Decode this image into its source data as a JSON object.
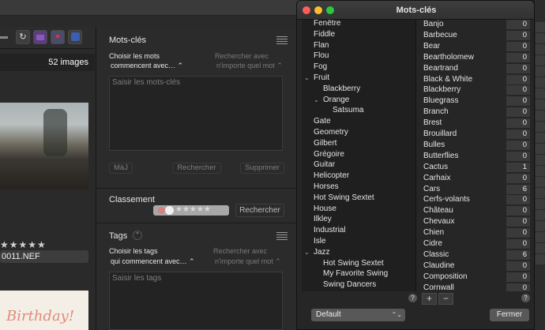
{
  "left_app": {
    "image_count": "52 images",
    "filename": "0011.NEF",
    "stars": "★★★★★",
    "card_text": "Birthday!",
    "toolbar_icons": [
      "refresh-icon",
      "folder-icon",
      "pin-icon",
      "app-icon"
    ]
  },
  "keywords_panel": {
    "title": "Mots-clés",
    "choose_words_label": "Choisir les mots",
    "words_mode": "commencent avec… ⌃",
    "search_with_label": "Rechercher avec",
    "search_with_mode": "n'importe quel mot ⌃",
    "keywords_placeholder": "Saisir les mots-clés",
    "update_button": "MàJ",
    "search_button": "Rechercher",
    "delete_button": "Supprimer"
  },
  "rating_panel": {
    "title": "Classement",
    "stars": "★★★★★",
    "search_button": "Rechercher"
  },
  "tags_panel": {
    "title": "Tags",
    "chevron": "⌃",
    "choose_tags_label": "Choisir les tags",
    "tags_mode": "qui commencent avec… ⌃",
    "search_with_label": "Rechercher avec",
    "search_with_mode": "n'importe quel mot ⌃",
    "tags_placeholder": "Saisir les tags"
  },
  "kw_window": {
    "title": "Mots-clés",
    "tree": [
      {
        "label": "Fenêtre",
        "level": 0
      },
      {
        "label": "Fiddle",
        "level": 0
      },
      {
        "label": "Flan",
        "level": 0
      },
      {
        "label": "Flou",
        "level": 0
      },
      {
        "label": "Fog",
        "level": 0
      },
      {
        "label": "Fruit",
        "level": 0,
        "expanded": true
      },
      {
        "label": "Blackberry",
        "level": 1
      },
      {
        "label": "Orange",
        "level": 1,
        "expanded": true
      },
      {
        "label": "Satsuma",
        "level": 2
      },
      {
        "label": "Gate",
        "level": 0
      },
      {
        "label": "Geometry",
        "level": 0
      },
      {
        "label": "Gilbert",
        "level": 0
      },
      {
        "label": "Grégoire",
        "level": 0
      },
      {
        "label": "Guitar",
        "level": 0
      },
      {
        "label": "Helicopter",
        "level": 0
      },
      {
        "label": "Horses",
        "level": 0
      },
      {
        "label": "Hot Swing Sextet",
        "level": 0
      },
      {
        "label": "House",
        "level": 0
      },
      {
        "label": "Ilkley",
        "level": 0
      },
      {
        "label": "Industrial",
        "level": 0
      },
      {
        "label": "Isle",
        "level": 0
      },
      {
        "label": "Jazz",
        "level": 0,
        "expanded": true
      },
      {
        "label": "Hot Swing Sextet",
        "level": 1
      },
      {
        "label": "My Favorite Swing",
        "level": 1
      },
      {
        "label": "Swing Dancers",
        "level": 1
      }
    ],
    "counts": [
      {
        "name": "Banjo",
        "count": "0"
      },
      {
        "name": "Barbecue",
        "count": "0"
      },
      {
        "name": "Bear",
        "count": "0"
      },
      {
        "name": "Beartholomew",
        "count": "0"
      },
      {
        "name": "Beartrand",
        "count": "0"
      },
      {
        "name": "Black & White",
        "count": "0"
      },
      {
        "name": "Blackberry",
        "count": "0"
      },
      {
        "name": "Bluegrass",
        "count": "0"
      },
      {
        "name": "Branch",
        "count": "0"
      },
      {
        "name": "Brest",
        "count": "0"
      },
      {
        "name": "Brouillard",
        "count": "0"
      },
      {
        "name": "Bulles",
        "count": "0"
      },
      {
        "name": "Butterflies",
        "count": "0"
      },
      {
        "name": "Cactus",
        "count": "1"
      },
      {
        "name": "Carhaix",
        "count": "0"
      },
      {
        "name": "Cars",
        "count": "6"
      },
      {
        "name": "Cerfs-volants",
        "count": "0"
      },
      {
        "name": "Château",
        "count": "0"
      },
      {
        "name": "Chevaux",
        "count": "0"
      },
      {
        "name": "Chien",
        "count": "0"
      },
      {
        "name": "Cidre",
        "count": "0"
      },
      {
        "name": "Classic",
        "count": "6"
      },
      {
        "name": "Claudine",
        "count": "0"
      },
      {
        "name": "Composition",
        "count": "0"
      },
      {
        "name": "Cornwall",
        "count": "0"
      }
    ],
    "help": "?",
    "add_button": "+",
    "remove_button": "−",
    "set_select": "Default",
    "set_select_chevron": "⌃⌄",
    "close_button": "Fermer"
  },
  "colors": {
    "close_light": "#fe5f57",
    "minimize_light": "#febc2e",
    "zoom_light": "#28c840",
    "toolbar_folder": "#8a56c4",
    "toolbar_pin": "#d93a3a",
    "toolbar_app": "#3a5fb0"
  }
}
